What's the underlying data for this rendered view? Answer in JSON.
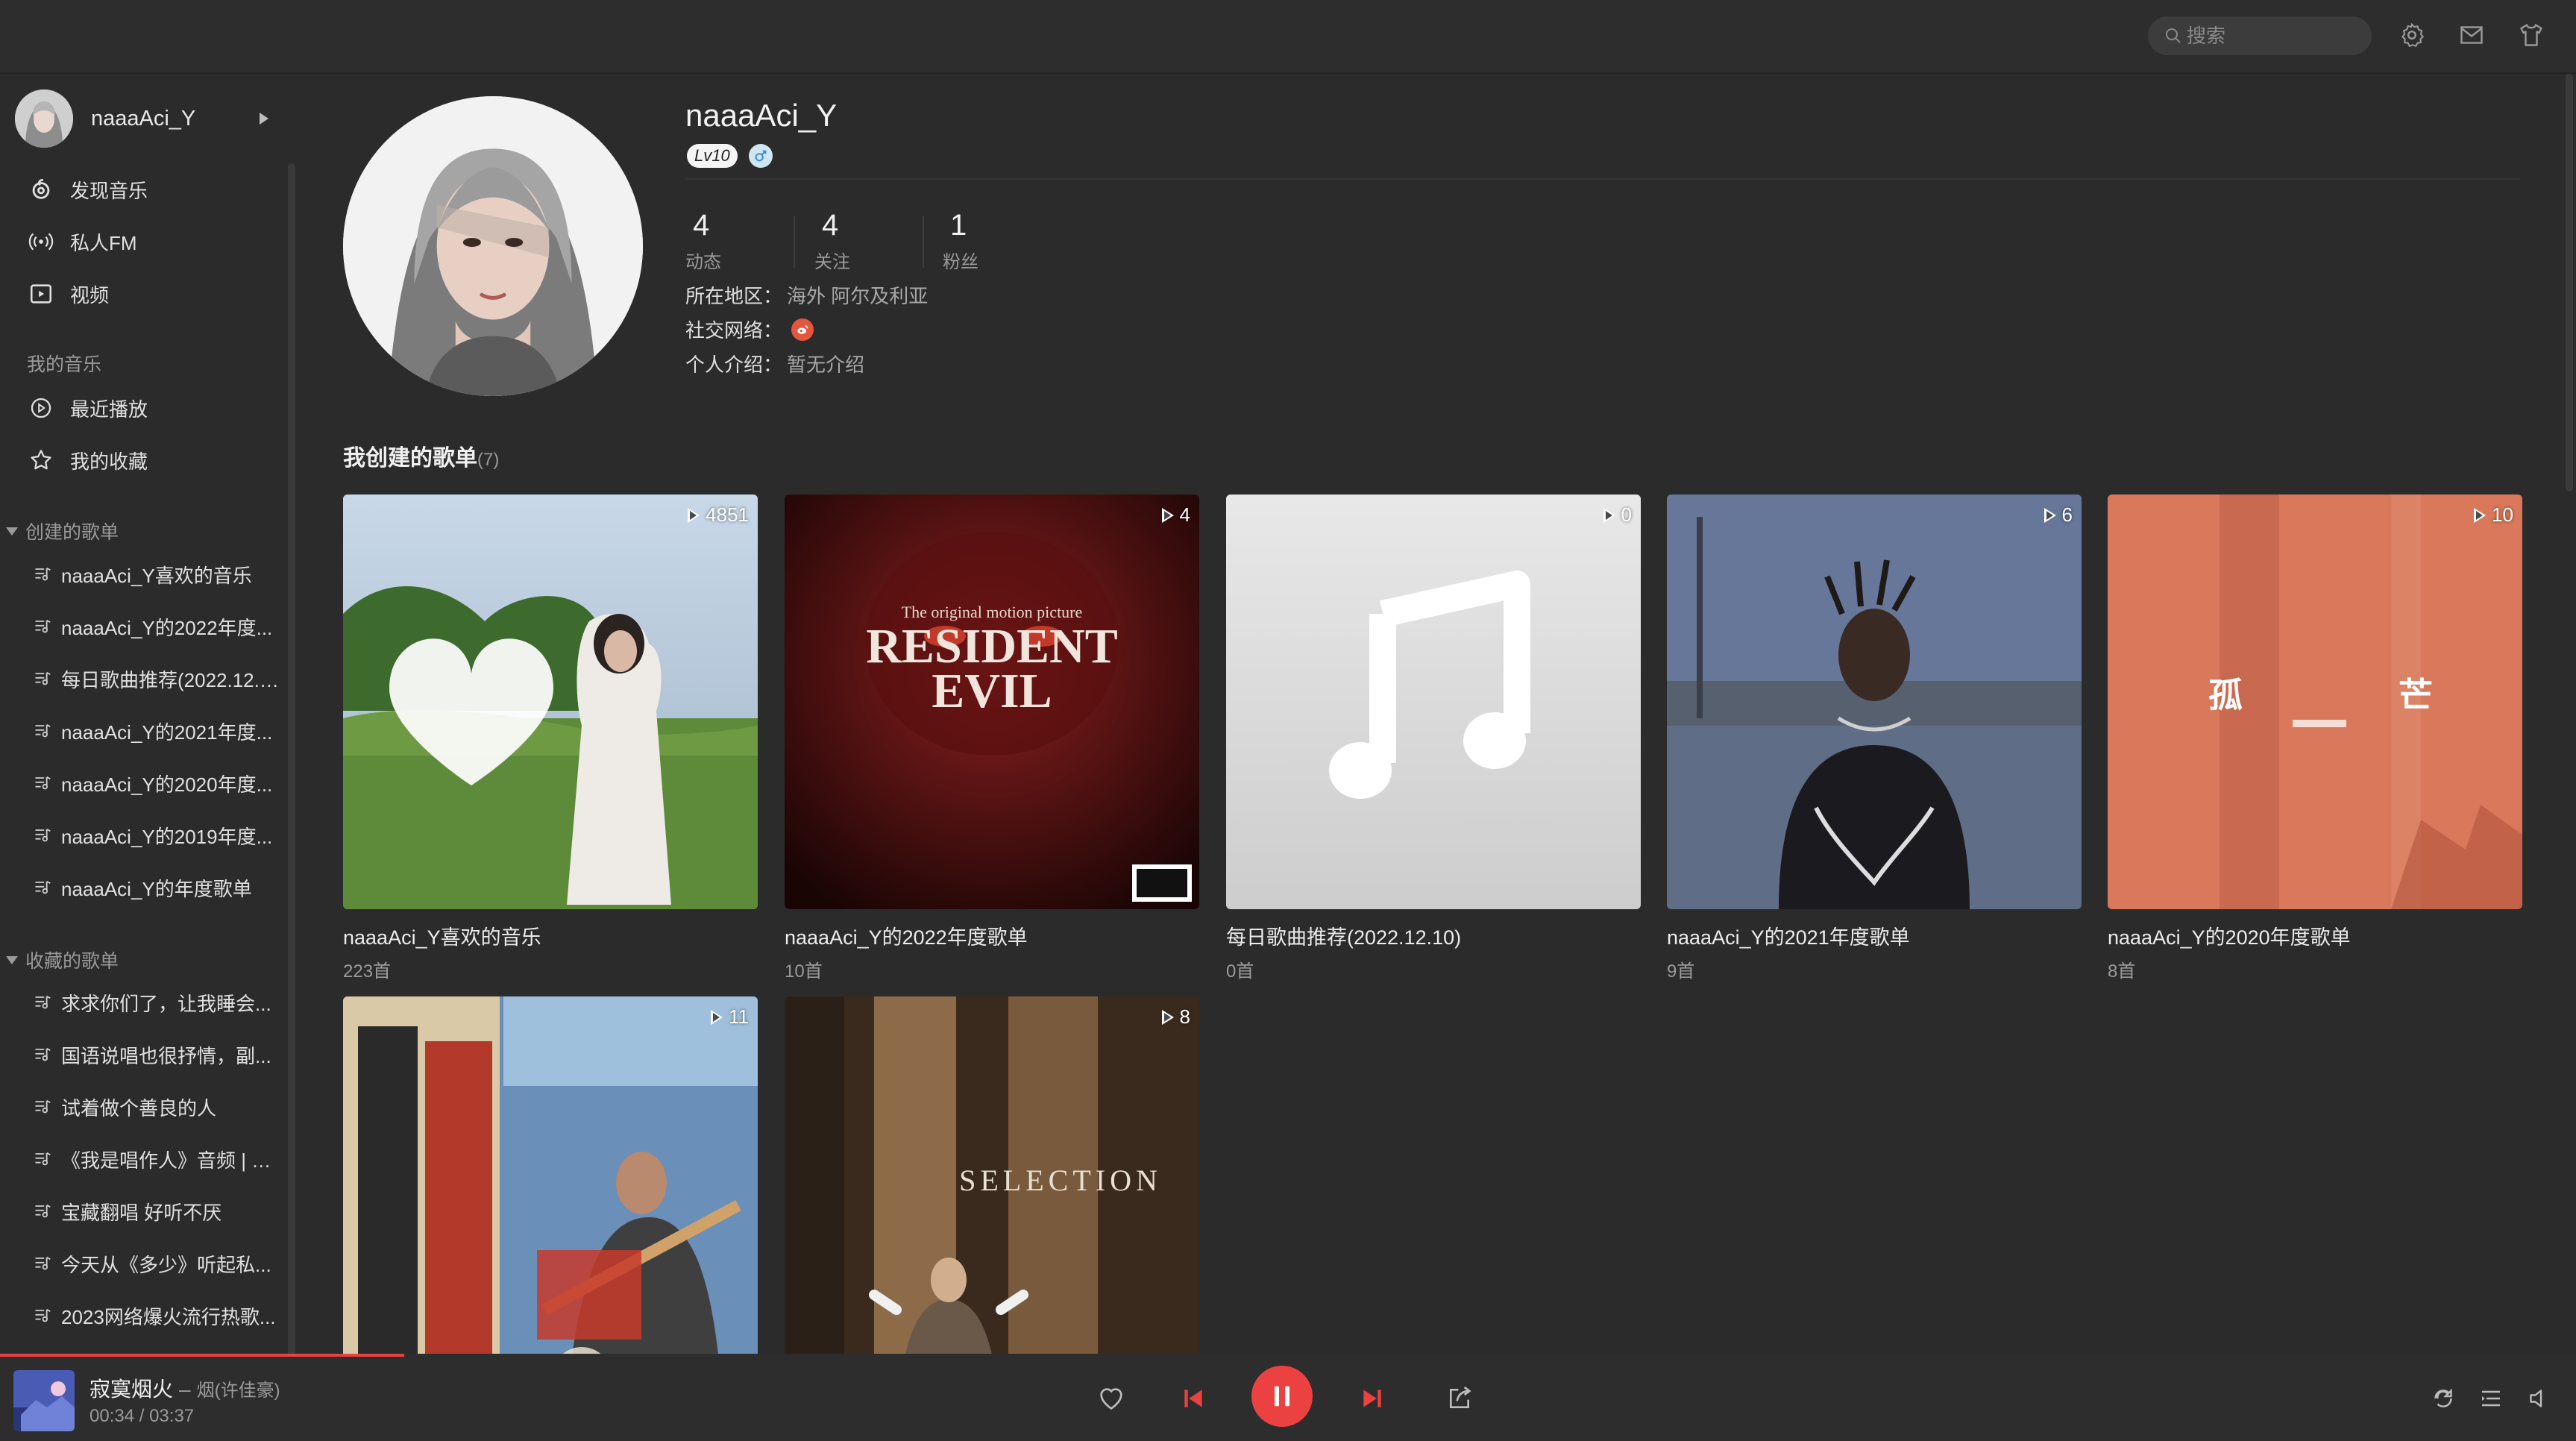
{
  "topbar": {
    "search_placeholder": "搜索",
    "icons": [
      "search-icon",
      "settings-icon",
      "mail-icon",
      "skin-icon"
    ]
  },
  "sidebar": {
    "user_name": "naaaAci_Y",
    "nav": [
      {
        "label": "发现音乐",
        "icon": "discover-icon"
      },
      {
        "label": "私人FM",
        "icon": "radio-icon"
      },
      {
        "label": "视频",
        "icon": "video-icon"
      }
    ],
    "my_music_title": "我的音乐",
    "my_music": [
      {
        "label": "最近播放",
        "icon": "recent-icon"
      },
      {
        "label": "我的收藏",
        "icon": "star-icon"
      }
    ],
    "created_title": "创建的歌单",
    "created": [
      "naaaAci_Y喜欢的音乐",
      "naaaAci_Y的2022年度...",
      "每日歌曲推荐(2022.12.10)",
      "naaaAci_Y的2021年度...",
      "naaaAci_Y的2020年度...",
      "naaaAci_Y的2019年度...",
      "naaaAci_Y的年度歌单"
    ],
    "collected_title": "收藏的歌单",
    "collected": [
      "求求你们了，让我睡会...",
      "国语说唱也很抒情，副...",
      "试着做个善良的人",
      "《我是唱作人》音频 | 热...",
      "宝藏翻唱 好听不厌",
      "今天从《多少》听起私...",
      "2023网络爆火流行热歌..."
    ]
  },
  "profile": {
    "name": "naaaAci_Y",
    "level": "Lv10",
    "stats": [
      {
        "num": "4",
        "label": "动态"
      },
      {
        "num": "4",
        "label": "关注"
      },
      {
        "num": "1",
        "label": "粉丝"
      }
    ],
    "region_label": "所在地区：",
    "region_value": "海外 阿尔及利亚",
    "social_label": "社交网络：",
    "intro_label": "个人介绍：",
    "intro_value": "暂无介绍"
  },
  "playlists": {
    "title": "我创建的歌单",
    "count": "(7)",
    "items": [
      {
        "name": "naaaAci_Y喜欢的音乐",
        "count": "223首",
        "plays": "4851"
      },
      {
        "name": "naaaAci_Y的2022年度歌单",
        "count": "10首",
        "plays": "4"
      },
      {
        "name": "每日歌曲推荐(2022.12.10)",
        "count": "0首",
        "plays": "0"
      },
      {
        "name": "naaaAci_Y的2021年度歌单",
        "count": "9首",
        "plays": "6"
      },
      {
        "name": "naaaAci_Y的2020年度歌单",
        "count": "8首",
        "plays": "10"
      },
      {
        "name": "",
        "count": "",
        "plays": "11"
      },
      {
        "name": "",
        "count": "",
        "plays": "8"
      }
    ]
  },
  "cover_text": {
    "p2_line1": "The original motion picture",
    "p2_line2": "RESIDENT",
    "p2_line3": "EVIL",
    "p5_left": "孤",
    "p5_right": "芒",
    "p7_text": "SELECTION"
  },
  "player": {
    "title": "寂寞烟火",
    "separator": "–",
    "artist": "烟(许佳豪)",
    "current_time": "00:34",
    "time_sep": "/",
    "total_time": "03:37",
    "progress": 0.157,
    "accent": "#ec4141"
  }
}
